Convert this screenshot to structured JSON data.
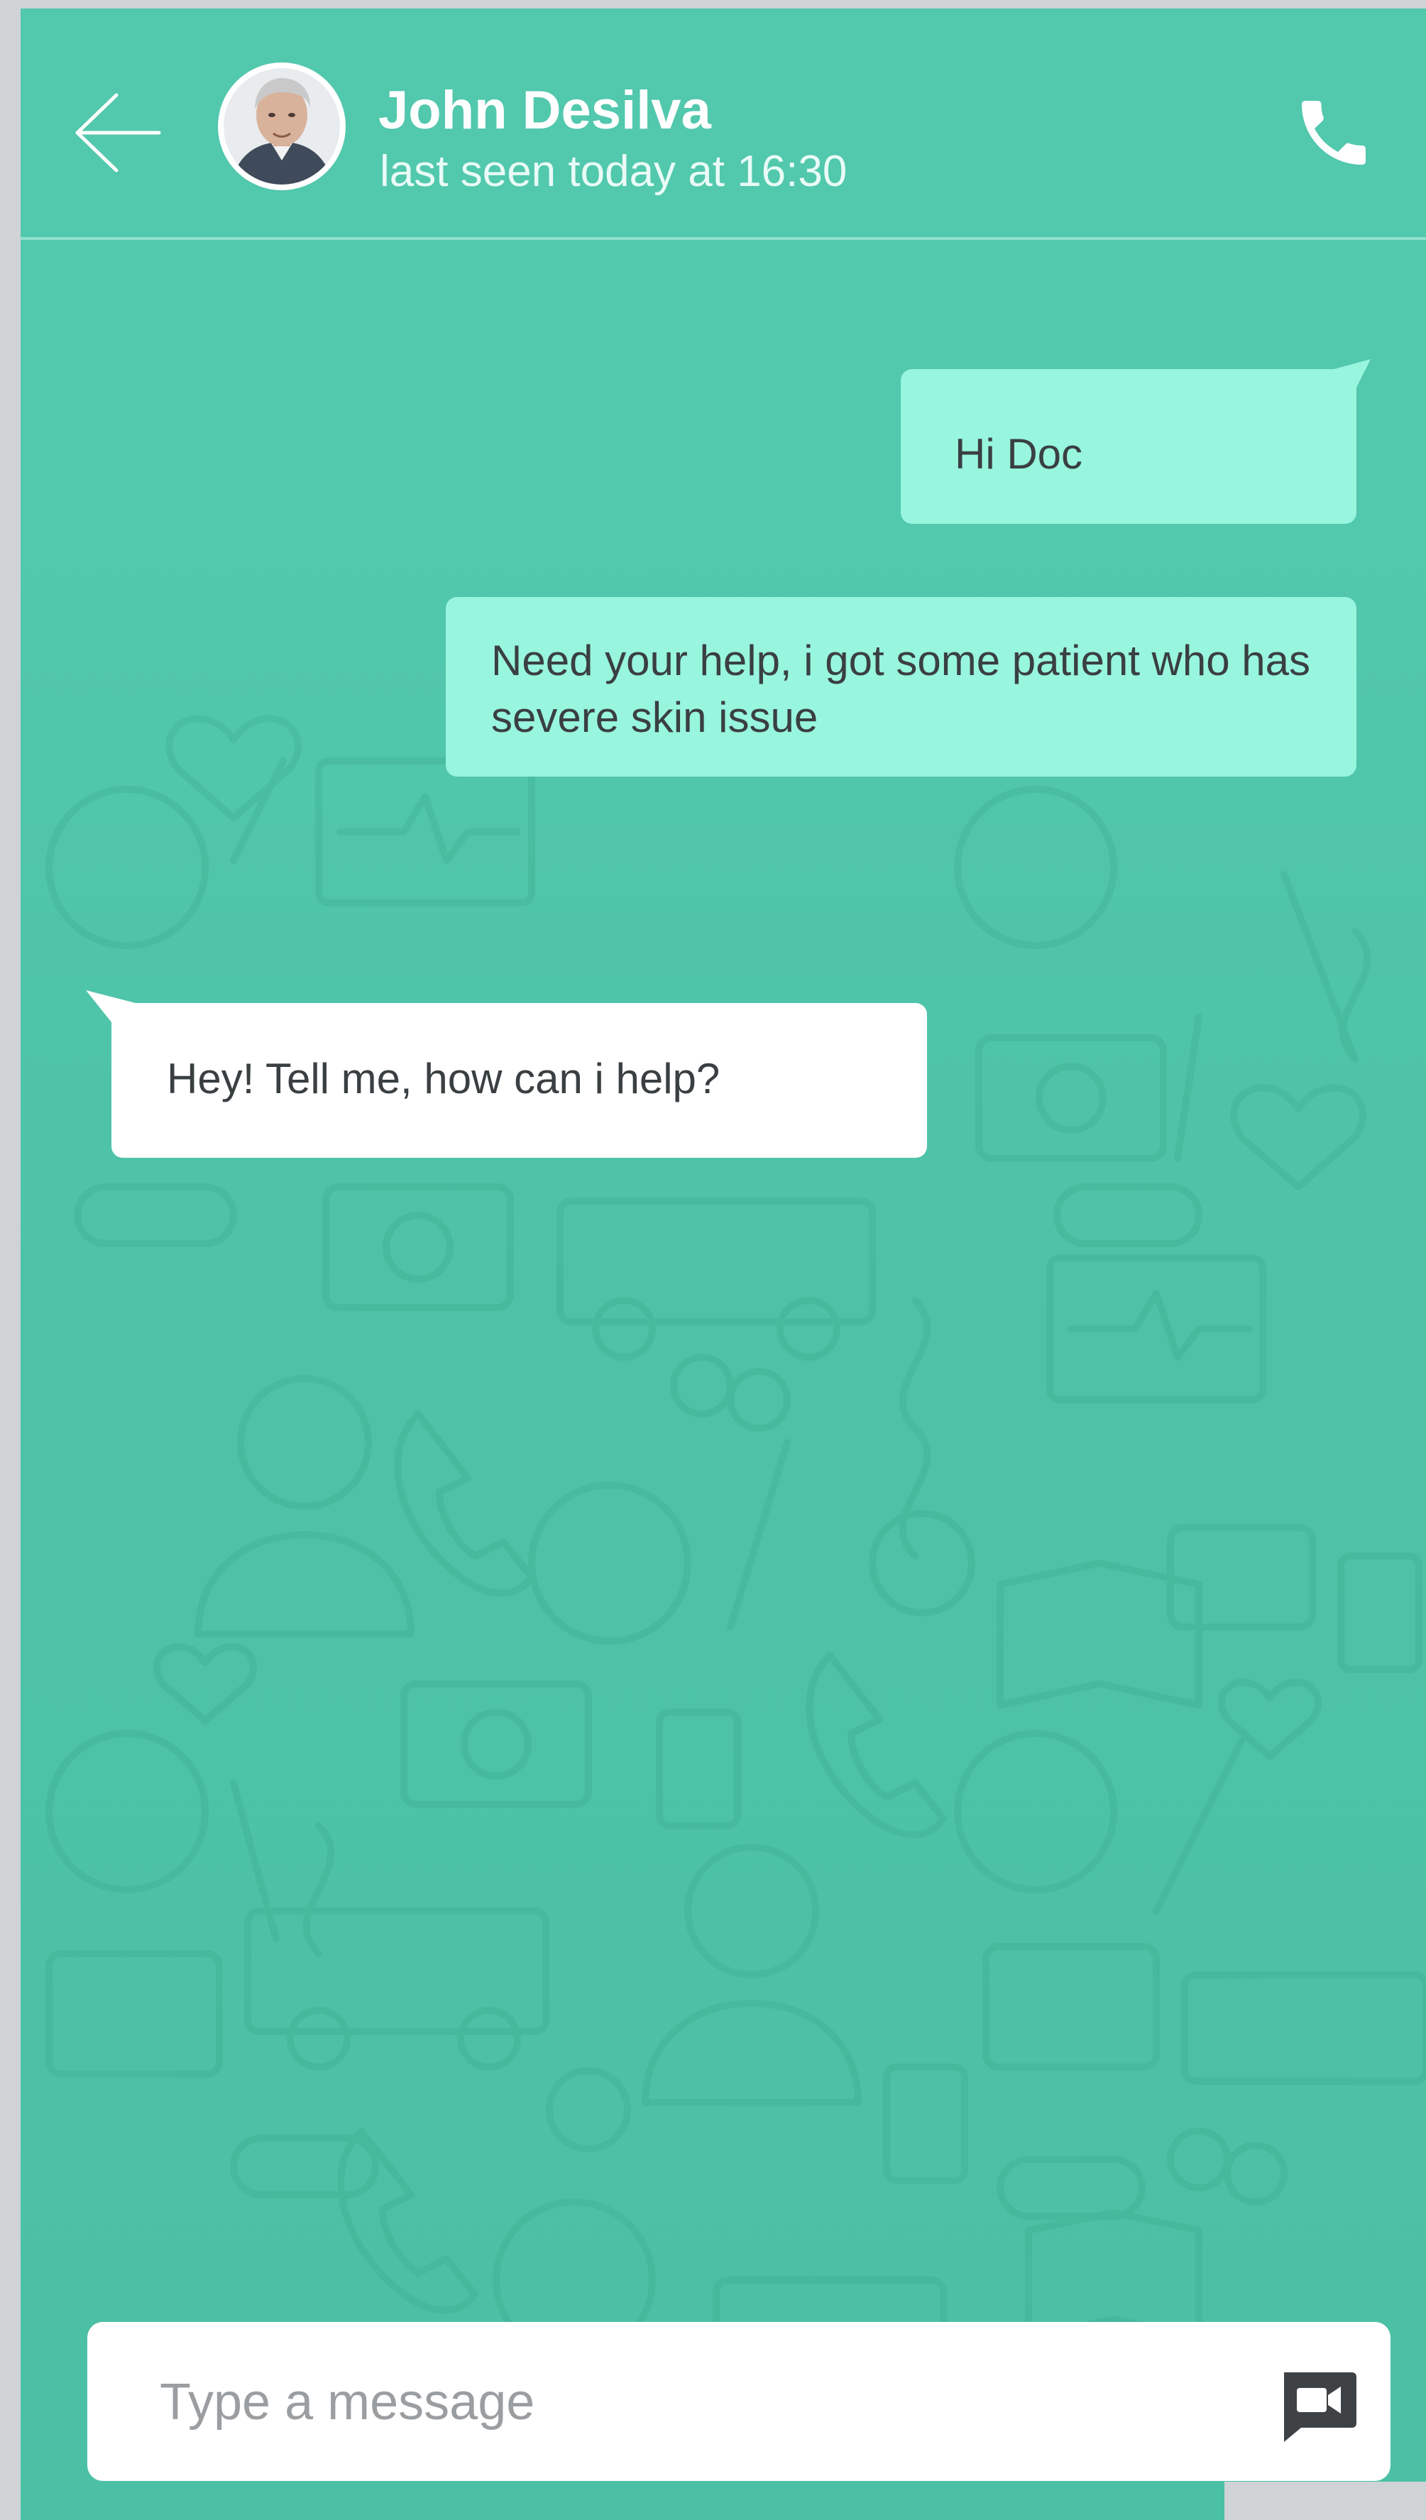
{
  "header": {
    "back_icon": "arrow-left-icon",
    "contact_name": "John Desilva",
    "last_seen": "last seen today at 16:30",
    "call_icon": "phone-icon"
  },
  "messages": [
    {
      "direction": "sent",
      "text": "Hi Doc"
    },
    {
      "direction": "sent",
      "text": "Need your help, i got some patient who has severe skin issue"
    },
    {
      "direction": "received",
      "text": "Hey! Tell me, how can i help?"
    }
  ],
  "composer": {
    "placeholder": "Type a message",
    "video_icon": "video-call-icon"
  },
  "colors": {
    "background": "#52c8ad",
    "sent_bubble": "#98f5de",
    "received_bubble": "#ffffff",
    "header_text": "#ffffff"
  }
}
